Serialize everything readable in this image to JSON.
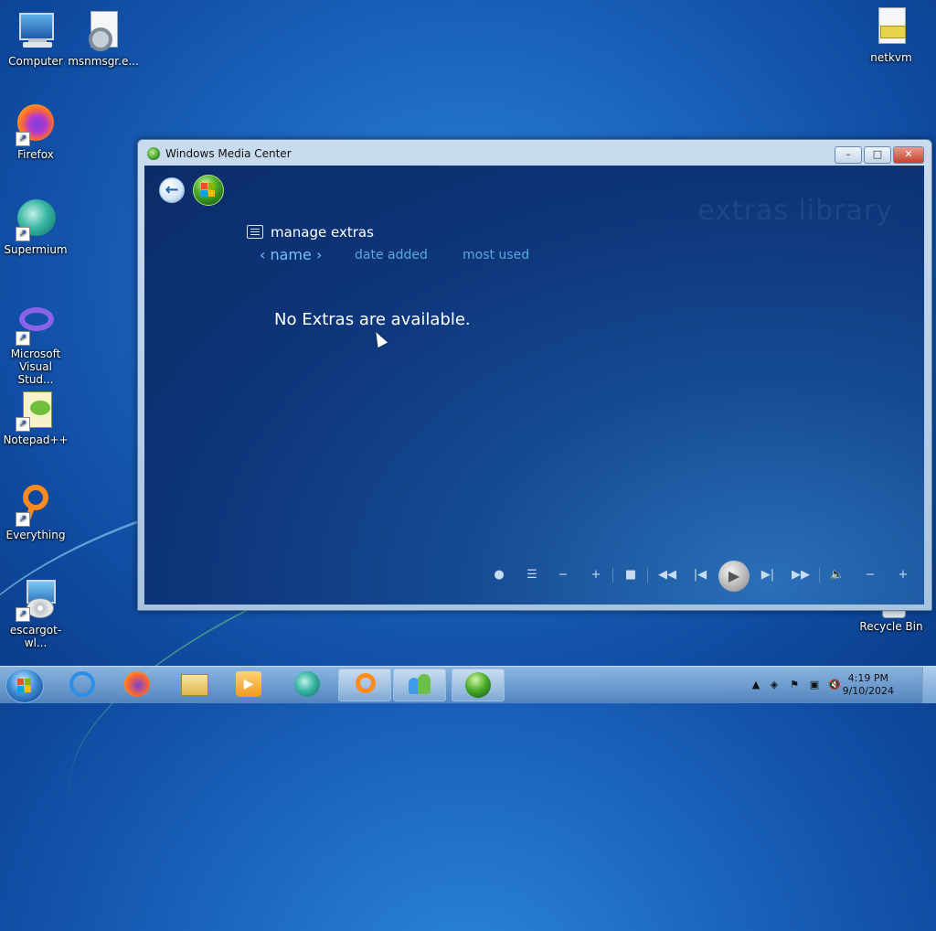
{
  "desktop": {
    "icons": [
      {
        "label": "Computer"
      },
      {
        "label": "msnmsgr.e..."
      },
      {
        "label": "netkvm"
      },
      {
        "label": "Firefox"
      },
      {
        "label": "Supermium"
      },
      {
        "label": "Microsoft Visual Stud..."
      },
      {
        "label": "Notepad++"
      },
      {
        "label": "Everything"
      },
      {
        "label": "escargot-wl..."
      },
      {
        "label": "Recycle Bin"
      }
    ]
  },
  "window": {
    "title": "Windows Media Center",
    "controls": {
      "minimize": "–",
      "maximize": "□",
      "close": "✕"
    },
    "background_title": "extras library",
    "header": "manage extras",
    "sort_options": [
      "name",
      "date added",
      "most used"
    ],
    "active_sort": "name",
    "empty_message": "No Extras are available."
  },
  "taskbar": {
    "clock_time": "4:19 PM",
    "clock_date": "9/10/2024"
  },
  "colors": {
    "accent": "#76c2ff",
    "content_bg": "#0e357a"
  }
}
